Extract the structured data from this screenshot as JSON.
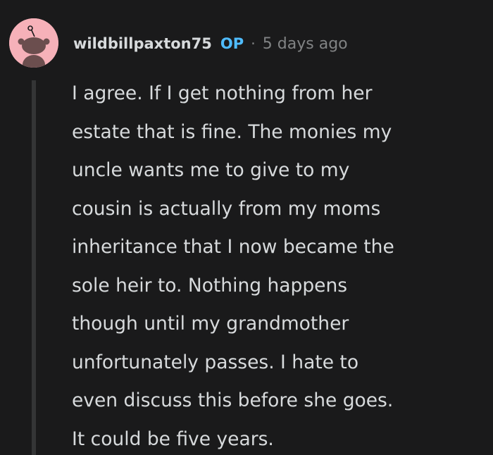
{
  "comment": {
    "avatar_icon": "reddit-snoo-avatar-icon",
    "avatar_bg": "#f6b1b9",
    "username": "wildbillpaxton75",
    "op_label": "OP",
    "separator": "·",
    "timestamp": "5 days ago",
    "body_lines": [
      "I agree. If I get nothing from her",
      "estate that is fine. The monies my",
      "uncle wants me to give to my",
      "cousin is actually from my moms",
      "inheritance that I now became the",
      "sole heir to. Nothing happens",
      "though until my grandmother",
      "unfortunately passes. I hate to",
      "even discuss this before she goes.",
      "It could be five years."
    ]
  },
  "colors": {
    "background": "#1a1a1b",
    "text": "#d7dadc",
    "meta": "#818384",
    "op_accent": "#4fbcff",
    "thread_line": "#343536"
  }
}
